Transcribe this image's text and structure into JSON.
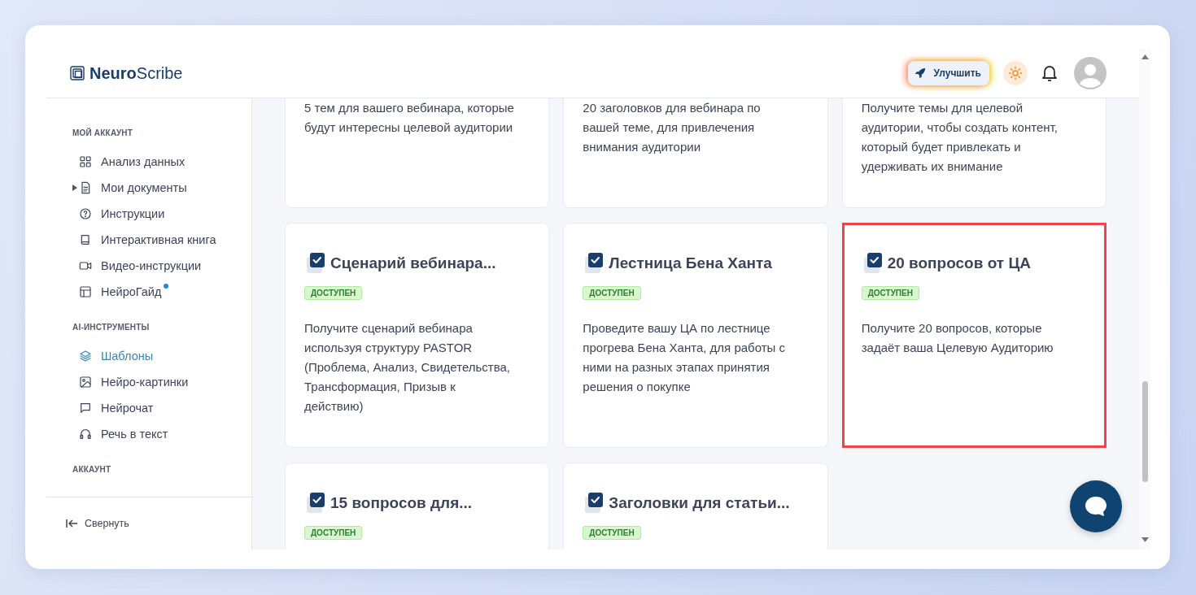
{
  "header": {
    "logo": "**Neuro**Scribe",
    "upgrade_button": "Улучшить"
  },
  "sidebar": {
    "sections": [
      {
        "title": "МОЙ АККАУНТ",
        "items": [
          {
            "label": "Анализ данных",
            "selected": false,
            "dot": false
          },
          {
            "label": "Мои документы",
            "selected": false,
            "dot": false,
            "expanded": false
          },
          {
            "label": "Инструкции",
            "selected": false,
            "dot": false
          },
          {
            "label": "Интерактивная книга",
            "selected": false,
            "dot": false
          },
          {
            "label": "Видео-инструкции",
            "selected": false,
            "dot": false
          },
          {
            "label": "НейроГайд",
            "selected": false,
            "dot": true
          }
        ]
      },
      {
        "title": "AI-ИНСТРУМЕНТЫ",
        "items": [
          {
            "label": "Шаблоны",
            "selected": true,
            "dot": false
          },
          {
            "label": "Нейро-картинки",
            "selected": false,
            "dot": false
          },
          {
            "label": "Нейрочат",
            "selected": false,
            "dot": false
          },
          {
            "label": "Речь в текст",
            "selected": false,
            "dot": false
          }
        ]
      },
      {
        "title": "АККАУНТ"
      }
    ],
    "collapse_button": "Свернуть"
  },
  "cards": [
    {
      "description": "5 тем для вашего вебинара, которые будут интересны целевой аудитории",
      "selected": false
    },
    {
      "description": "20 заголовков для вебинара по вашей теме, для привлечения внимания аудитории",
      "selected": false
    },
    {
      "description": "Получите темы для целевой аудитории, чтобы создать контент, который будет привлекать и удерживать их внимание",
      "selected": false
    },
    {
      "title": "Сценарий вебинара...",
      "badge": "ДОСТУПЕН",
      "description": "Получите сценарий вебинара используя структуру PASTOR (Проблема, Анализ, Свидетельства, Трансформация, Призыв к действию)",
      "selected": false
    },
    {
      "title": "Лестница Бена Ханта",
      "badge": "ДОСТУПЕН",
      "description": "Проведите вашу ЦА по лестнице прогрева Бена Ханта, для работы с ними на разных этапах принятия решения о покупке",
      "selected": false
    },
    {
      "title": "20 вопросов от ЦА",
      "badge": "ДОСТУПЕН",
      "description": "Получите 20 вопросов, которые задаёт ваша Целевую Аудиторию",
      "selected": true
    },
    {
      "title": "15 вопросов для...",
      "badge": "ДОСТУПЕН",
      "selected": false
    },
    {
      "title": "Заголовки для статьи...",
      "badge": "ДОСТУПЕН",
      "selected": false
    }
  ]
}
